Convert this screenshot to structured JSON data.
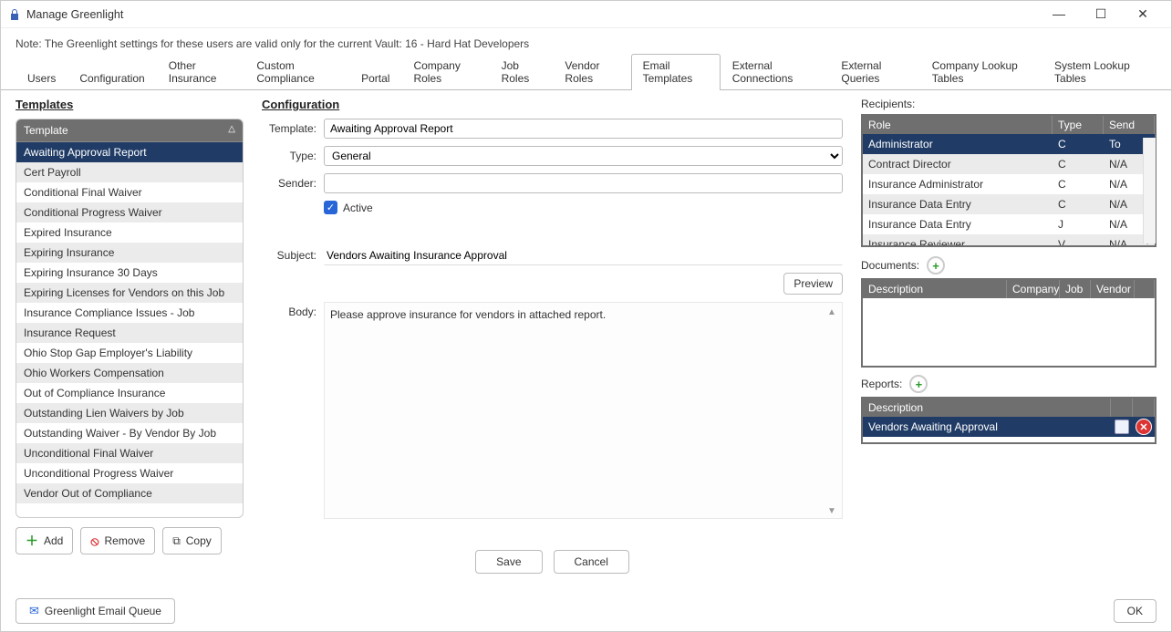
{
  "window": {
    "title": "Manage Greenlight"
  },
  "note": "Note:  The Greenlight settings for these users are valid only for the current Vault: 16 - Hard Hat Developers",
  "tabs": {
    "items": [
      "Users",
      "Configuration",
      "Other Insurance",
      "Custom Compliance",
      "Portal",
      "Company Roles",
      "Job Roles",
      "Vendor Roles",
      "Email Templates",
      "External Connections",
      "External Queries",
      "Company Lookup Tables",
      "System Lookup Tables"
    ],
    "active": "Email Templates"
  },
  "left": {
    "heading": "Templates",
    "column_header": "Template",
    "items": [
      "Awaiting Approval Report",
      "Cert Payroll",
      "Conditional Final Waiver",
      "Conditional Progress Waiver",
      "Expired Insurance",
      "Expiring Insurance",
      "Expiring Insurance 30 Days",
      "Expiring Licenses for Vendors on this Job",
      "Insurance Compliance Issues - Job",
      "Insurance Request",
      "Ohio Stop Gap Employer's Liability",
      "Ohio Workers Compensation",
      "Out of Compliance Insurance",
      "Outstanding Lien Waivers by Job",
      "Outstanding Waiver - By Vendor By Job",
      "Unconditional Final Waiver",
      "Unconditional Progress Waiver",
      "Vendor Out of Compliance"
    ],
    "selected": "Awaiting Approval Report",
    "buttons": {
      "add": "Add",
      "remove": "Remove",
      "copy": "Copy"
    }
  },
  "center": {
    "heading": "Configuration",
    "labels": {
      "template": "Template:",
      "type": "Type:",
      "sender": "Sender:",
      "active": "Active",
      "subject": "Subject:",
      "body": "Body:",
      "preview": "Preview",
      "save": "Save",
      "cancel": "Cancel"
    },
    "values": {
      "template": "Awaiting Approval Report",
      "type": "General",
      "sender": "",
      "active": true,
      "subject": "Vendors Awaiting Insurance Approval",
      "body": "Please approve insurance for vendors in attached report."
    }
  },
  "right": {
    "recipients_label": "Recipients:",
    "recipients_cols": {
      "role": "Role",
      "type": "Type",
      "send": "Send"
    },
    "recipients": [
      {
        "role": "Administrator",
        "type": "C",
        "send": "To",
        "selected": true
      },
      {
        "role": "Contract Director",
        "type": "C",
        "send": "N/A"
      },
      {
        "role": "Insurance Administrator",
        "type": "C",
        "send": "N/A"
      },
      {
        "role": "Insurance Data Entry",
        "type": "C",
        "send": "N/A"
      },
      {
        "role": "Insurance Data Entry",
        "type": "J",
        "send": "N/A"
      },
      {
        "role": "Insurance Reviewer",
        "type": "V",
        "send": "N/A"
      }
    ],
    "documents_label": "Documents:",
    "documents_cols": {
      "desc": "Description",
      "company": "Company",
      "job": "Job",
      "vendor": "Vendor"
    },
    "reports_label": "Reports:",
    "reports_cols": {
      "desc": "Description"
    },
    "reports": [
      {
        "desc": "Vendors Awaiting Approval"
      }
    ]
  },
  "footer": {
    "queue": "Greenlight Email Queue",
    "ok": "OK"
  }
}
